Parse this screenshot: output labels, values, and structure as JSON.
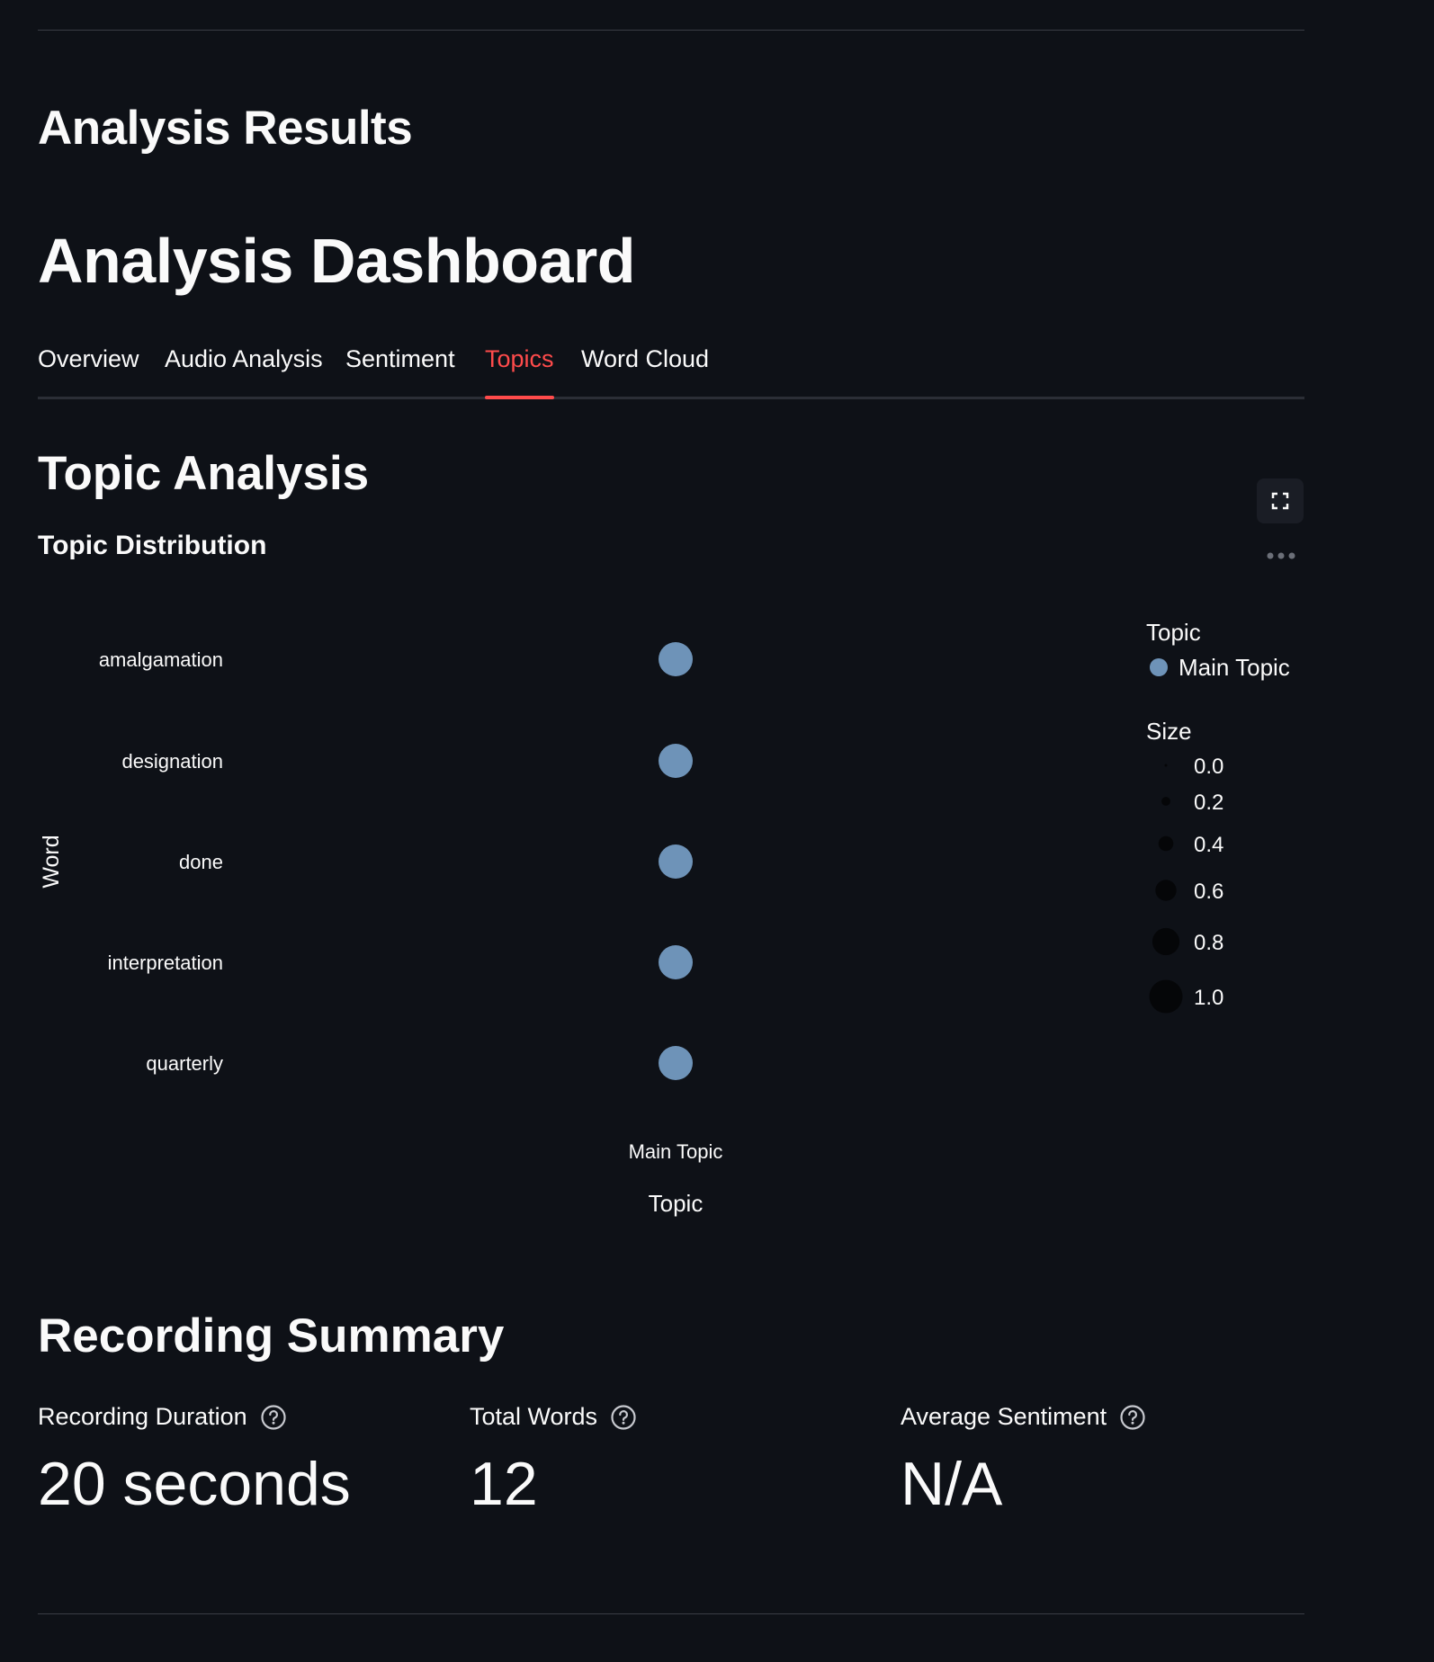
{
  "header": {
    "results_title": "Analysis Results",
    "dashboard_title": "Analysis Dashboard"
  },
  "tabs": [
    {
      "label": "Overview",
      "active": false
    },
    {
      "label": "Audio Analysis",
      "active": false
    },
    {
      "label": "Sentiment",
      "active": false
    },
    {
      "label": "Topics",
      "active": true
    },
    {
      "label": "Word Cloud",
      "active": false
    }
  ],
  "topic_section": {
    "title": "Topic Analysis",
    "subtitle": "Topic Distribution"
  },
  "icons": {
    "fullscreen": "fullscreen-icon",
    "more": "more-horizontal-icon",
    "help": "question-circle-icon"
  },
  "colors": {
    "accent": "#ff4b4b",
    "point": "#6e93b8",
    "background": "#0e1117",
    "size_legend": "#050608"
  },
  "chart_data": {
    "type": "scatter",
    "xlabel": "Topic",
    "ylabel": "Word",
    "x_categories": [
      "Main Topic"
    ],
    "y_categories": [
      "amalgamation",
      "designation",
      "done",
      "interpretation",
      "quarterly"
    ],
    "points": [
      {
        "x": "Main Topic",
        "y": "amalgamation",
        "topic": "Main Topic",
        "size": 1.0
      },
      {
        "x": "Main Topic",
        "y": "designation",
        "topic": "Main Topic",
        "size": 1.0
      },
      {
        "x": "Main Topic",
        "y": "done",
        "topic": "Main Topic",
        "size": 1.0
      },
      {
        "x": "Main Topic",
        "y": "interpretation",
        "topic": "Main Topic",
        "size": 1.0
      },
      {
        "x": "Main Topic",
        "y": "quarterly",
        "topic": "Main Topic",
        "size": 1.0
      }
    ],
    "legend": {
      "color_title": "Topic",
      "color_entries": [
        "Main Topic"
      ],
      "size_title": "Size",
      "size_entries": [
        "0.0",
        "0.2",
        "0.4",
        "0.6",
        "0.8",
        "1.0"
      ]
    },
    "grid": false,
    "legend_position": "right"
  },
  "summary": {
    "title": "Recording Summary",
    "metrics": [
      {
        "label": "Recording Duration",
        "value": "20 seconds"
      },
      {
        "label": "Total Words",
        "value": "12"
      },
      {
        "label": "Average Sentiment",
        "value": "N/A"
      }
    ]
  }
}
